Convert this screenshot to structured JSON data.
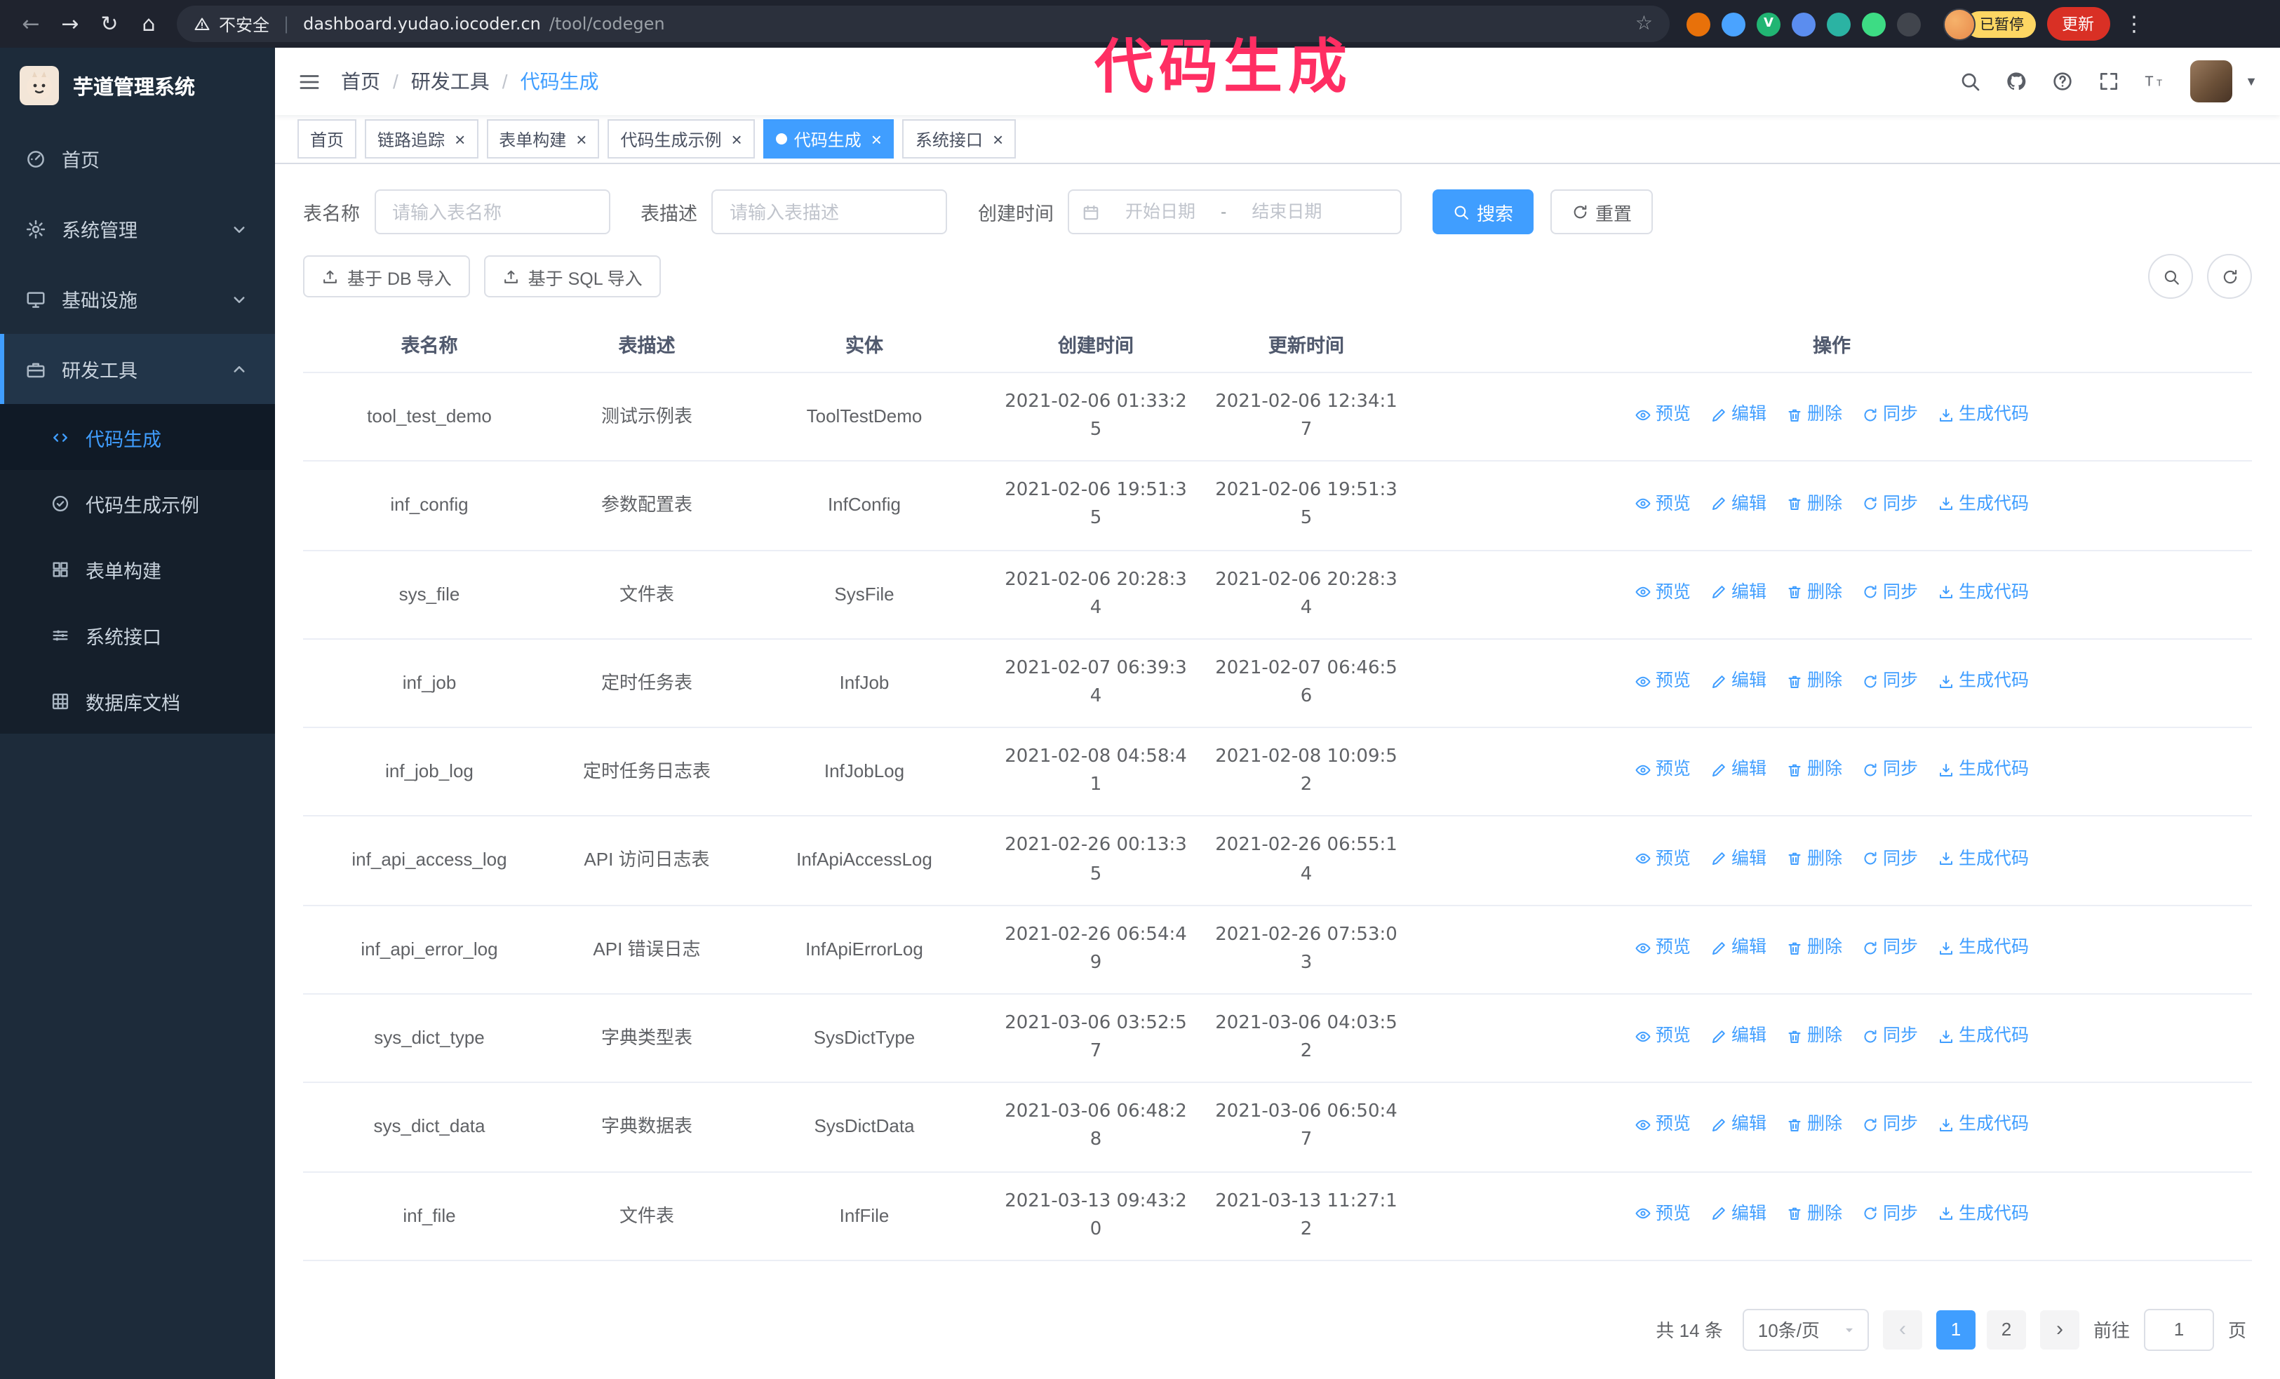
{
  "annotation": {
    "text": "代码生成",
    "color": "#ff2e63"
  },
  "browser": {
    "back": "←",
    "forward": "→",
    "reload": "↻",
    "home": "⌂",
    "security_label": "不安全",
    "url_host": "dashboard.yudao.iocoder.cn",
    "url_path": "/tool/codegen",
    "star": "☆",
    "extensions": [
      {
        "name": "fox-extension-icon",
        "color": "#e8710a",
        "label": ""
      },
      {
        "name": "drop-extension-icon",
        "color": "#4aa3ff",
        "label": ""
      },
      {
        "name": "vue-devtools-extension-icon",
        "color": "#21b573",
        "label": "V"
      },
      {
        "name": "people-extension-icon",
        "color": "#5b8def",
        "label": ""
      },
      {
        "name": "teal-extension-icon",
        "color": "#2bb3a3",
        "label": ""
      },
      {
        "name": "leaf-extension-icon",
        "color": "#3ddc84",
        "label": ""
      },
      {
        "name": "pretzel-extension-icon",
        "color": "#41454d",
        "label": ""
      }
    ],
    "profile_badge": "已暂停",
    "update_button": "更新",
    "menu": "⋮"
  },
  "sidebar": {
    "logo_title": "芋道管理系统",
    "items": [
      {
        "id": "home",
        "icon": "dashboard",
        "label": "首页"
      },
      {
        "id": "system-management",
        "icon": "gear",
        "label": "系统管理",
        "chevron": "down"
      },
      {
        "id": "infrastructure",
        "icon": "monitor",
        "label": "基础设施",
        "chevron": "down"
      },
      {
        "id": "dev-tools",
        "icon": "toolbox",
        "label": "研发工具",
        "chevron": "up",
        "expanded": true,
        "children": [
          {
            "id": "codegen",
            "icon": "code",
            "label": "代码生成",
            "active": true
          },
          {
            "id": "codegen-example",
            "icon": "badge",
            "label": "代码生成示例"
          },
          {
            "id": "form-builder",
            "icon": "form",
            "label": "表单构建"
          },
          {
            "id": "system-api",
            "icon": "api",
            "label": "系统接口"
          },
          {
            "id": "db-doc",
            "icon": "dbgrid",
            "label": "数据库文档"
          }
        ]
      }
    ]
  },
  "header": {
    "breadcrumb": [
      "首页",
      "研发工具",
      "代码生成"
    ],
    "icons": [
      {
        "name": "search"
      },
      {
        "name": "github"
      },
      {
        "name": "question"
      },
      {
        "name": "fullscreen"
      },
      {
        "name": "fontsize"
      }
    ]
  },
  "tabs": {
    "items": [
      {
        "id": "home",
        "label": "首页",
        "closable": false,
        "active": false
      },
      {
        "id": "trace",
        "label": "链路追踪",
        "closable": true,
        "active": false
      },
      {
        "id": "form-builder",
        "label": "表单构建",
        "closable": true,
        "active": false
      },
      {
        "id": "codegen-example",
        "label": "代码生成示例",
        "closable": true,
        "active": false
      },
      {
        "id": "codegen",
        "label": "代码生成",
        "closable": true,
        "active": true
      },
      {
        "id": "system-api",
        "label": "系统接口",
        "closable": true,
        "active": false
      }
    ]
  },
  "filters": {
    "table_name_label": "表名称",
    "table_name_placeholder": "请输入表名称",
    "table_desc_label": "表描述",
    "table_desc_placeholder": "请输入表描述",
    "create_time_label": "创建时间",
    "date_start_placeholder": "开始日期",
    "date_separator": "-",
    "date_end_placeholder": "结束日期",
    "search_button": "搜索",
    "reset_button": "重置"
  },
  "toolbar": {
    "import_db": "基于 DB 导入",
    "import_sql": "基于 SQL 导入"
  },
  "table": {
    "columns": [
      "表名称",
      "表描述",
      "实体",
      "创建时间",
      "更新时间",
      "操作"
    ],
    "row_actions": [
      {
        "name": "preview",
        "icon": "eye",
        "label": "预览"
      },
      {
        "name": "edit",
        "icon": "pencil",
        "label": "编辑"
      },
      {
        "name": "delete",
        "icon": "trash",
        "label": "删除"
      },
      {
        "name": "sync",
        "icon": "sync",
        "label": "同步"
      },
      {
        "name": "generate-code",
        "icon": "download",
        "label": "生成代码"
      }
    ],
    "rows": [
      {
        "name": "tool_test_demo",
        "desc": "测试示例表",
        "entity": "ToolTestDemo",
        "created": "2021-02-06 01:33:25",
        "updated": "2021-02-06 12:34:17"
      },
      {
        "name": "inf_config",
        "desc": "参数配置表",
        "entity": "InfConfig",
        "created": "2021-02-06 19:51:35",
        "updated": "2021-02-06 19:51:35"
      },
      {
        "name": "sys_file",
        "desc": "文件表",
        "entity": "SysFile",
        "created": "2021-02-06 20:28:34",
        "updated": "2021-02-06 20:28:34"
      },
      {
        "name": "inf_job",
        "desc": "定时任务表",
        "entity": "InfJob",
        "created": "2021-02-07 06:39:34",
        "updated": "2021-02-07 06:46:56"
      },
      {
        "name": "inf_job_log",
        "desc": "定时任务日志表",
        "entity": "InfJobLog",
        "created": "2021-02-08 04:58:41",
        "updated": "2021-02-08 10:09:52"
      },
      {
        "name": "inf_api_access_log",
        "desc": "API 访问日志表",
        "entity": "InfApiAccessLog",
        "created": "2021-02-26 00:13:35",
        "updated": "2021-02-26 06:55:14"
      },
      {
        "name": "inf_api_error_log",
        "desc": "API 错误日志",
        "entity": "InfApiErrorLog",
        "created": "2021-02-26 06:54:49",
        "updated": "2021-02-26 07:53:03"
      },
      {
        "name": "sys_dict_type",
        "desc": "字典类型表",
        "entity": "SysDictType",
        "created": "2021-03-06 03:52:57",
        "updated": "2021-03-06 04:03:52"
      },
      {
        "name": "sys_dict_data",
        "desc": "字典数据表",
        "entity": "SysDictData",
        "created": "2021-03-06 06:48:28",
        "updated": "2021-03-06 06:50:47"
      },
      {
        "name": "inf_file",
        "desc": "文件表",
        "entity": "InfFile",
        "created": "2021-03-13 09:43:20",
        "updated": "2021-03-13 11:27:12"
      }
    ]
  },
  "pagination": {
    "total_text": "共 14 条",
    "page_size": "10条/页",
    "prev": "‹",
    "next": "›",
    "pages": [
      "1",
      "2"
    ],
    "active_page": "1",
    "goto_label": "前往",
    "goto_value": "1",
    "goto_suffix": "页"
  },
  "colors": {
    "accent": "#409eff",
    "sidebar_bg": "#1d2b3a",
    "chrome_bg": "#1f232e",
    "annotation": "#ff2e63"
  }
}
